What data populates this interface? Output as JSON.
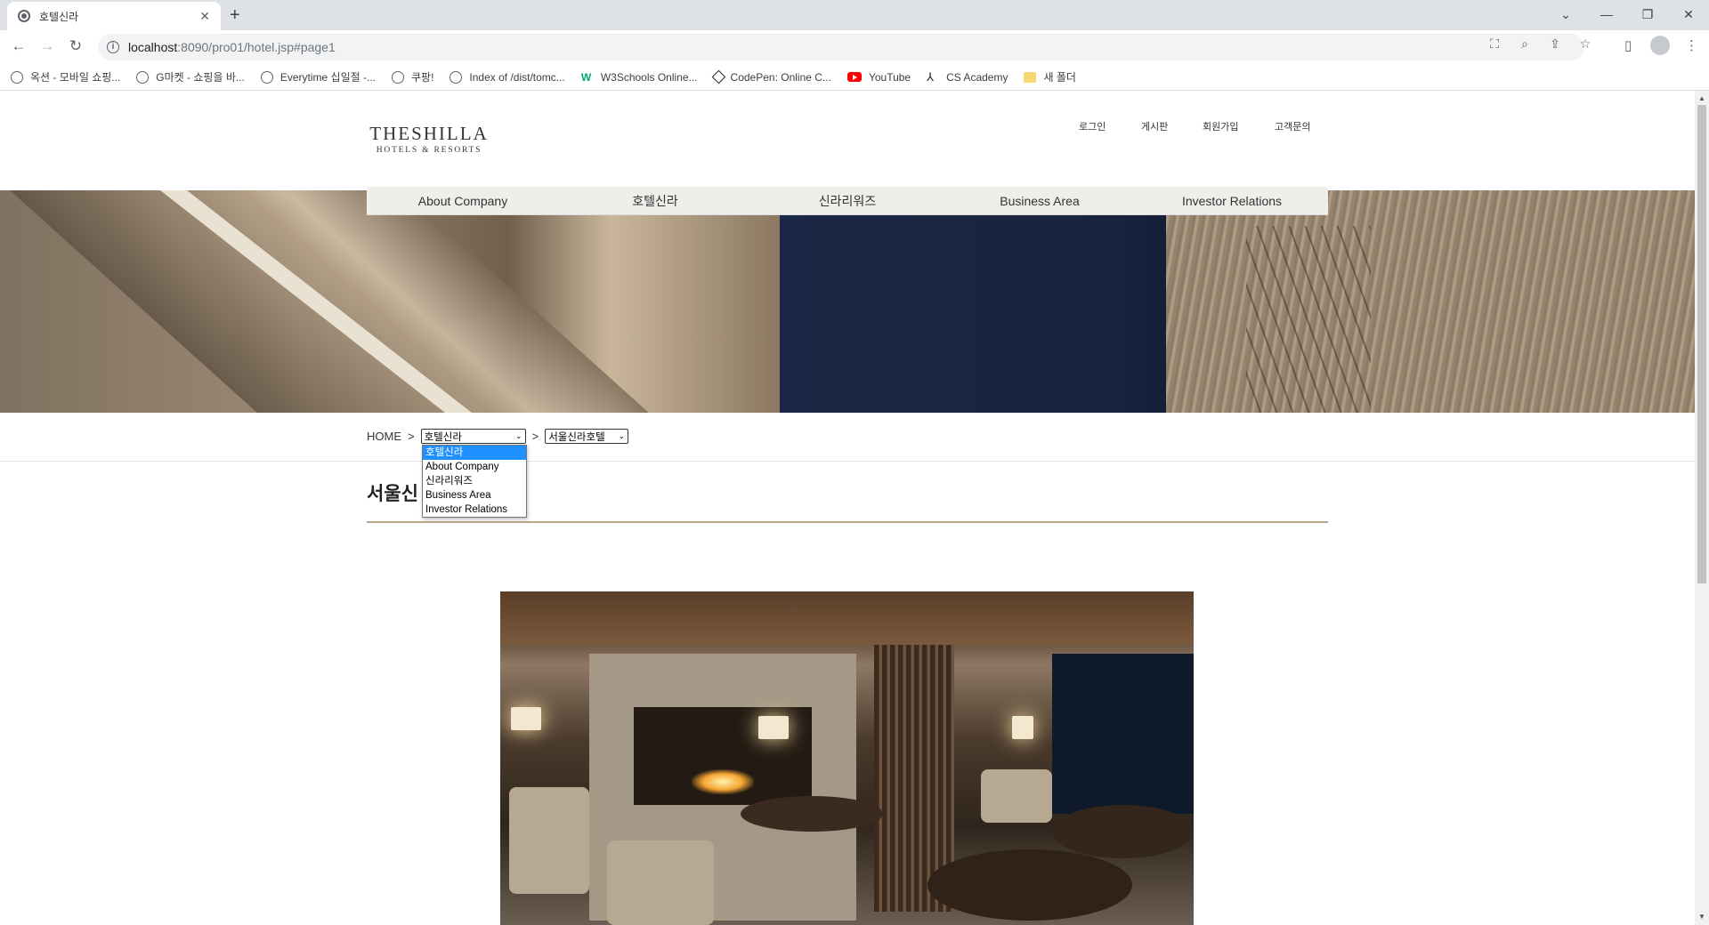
{
  "browser": {
    "tab_title": "호텔신라",
    "tab_close": "✕",
    "new_tab": "+",
    "url_host": "localhost",
    "url_path": ":8090/pro01/hotel.jsp#page1",
    "bookmarks": [
      {
        "label": "옥션 - 모바일 쇼핑...",
        "icon": "globe-icon"
      },
      {
        "label": "G마켓 - 쇼핑을 바...",
        "icon": "globe-icon"
      },
      {
        "label": "Everytime 십일절 -...",
        "icon": "globe-icon"
      },
      {
        "label": "쿠팡!",
        "icon": "globe-icon"
      },
      {
        "label": "Index of /dist/tomc...",
        "icon": "globe-icon"
      },
      {
        "label": "W3Schools Online...",
        "icon": "w3schools-icon"
      },
      {
        "label": "CodePen: Online C...",
        "icon": "codepen-icon"
      },
      {
        "label": "YouTube",
        "icon": "youtube-icon"
      },
      {
        "label": "CS Academy",
        "icon": "cs-academy-icon"
      },
      {
        "label": "새 폴더",
        "icon": "folder-icon"
      }
    ]
  },
  "header": {
    "logo_line1": "THESHILLA",
    "logo_line2": "HOTELS & RESORTS",
    "util_links": [
      "로그인",
      "게시판",
      "회원가입",
      "고객문의"
    ]
  },
  "gnb": {
    "items": [
      "About Company",
      "호텔신라",
      "신라리워즈",
      "Business Area",
      "Investor Relations"
    ]
  },
  "location": {
    "home": "HOME",
    "separator": ">",
    "main_select_value": "호텔신라",
    "sub_select_value": "서울신라호텔",
    "dropdown_options": [
      "호텔신라",
      "About Company",
      "신라리워즈",
      "Business Area",
      "Investor Relations"
    ]
  },
  "content": {
    "page_title": "서울신"
  }
}
